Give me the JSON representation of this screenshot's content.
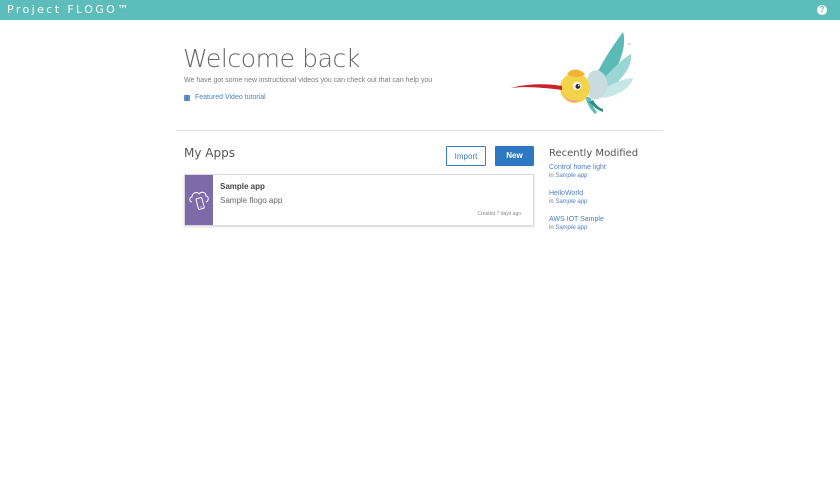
{
  "header": {
    "brand": "Project FLOGO™",
    "help_label": "?"
  },
  "welcome": {
    "title": "Welcome back",
    "subtitle": "We have got some new instructional videos you can check out that can help you",
    "video_link": "Featured Video tutorial"
  },
  "apps": {
    "title": "My Apps",
    "import_label": "Import",
    "new_label": "New",
    "items": [
      {
        "name": "Sample app",
        "description": "Sample flogo app",
        "created": "Created 7 days ago"
      }
    ]
  },
  "recent": {
    "title": "Recently Modified",
    "items": [
      {
        "name": "Control home light",
        "in_prefix": "in",
        "app": "Sample app"
      },
      {
        "name": "HelloWorld",
        "in_prefix": "in",
        "app": "Sample app"
      },
      {
        "name": "AWS IOT Sample",
        "in_prefix": "in",
        "app": "Sample app"
      }
    ]
  },
  "icons": {
    "film": "film-icon",
    "app": "mobile-cloud-icon",
    "mascot": "hummingbird-logo"
  },
  "colors": {
    "header_bg": "#5dbdbb",
    "primary": "#2f79c2",
    "link": "#4a7fc0",
    "app_icon_bg": "#7d6aa9"
  }
}
